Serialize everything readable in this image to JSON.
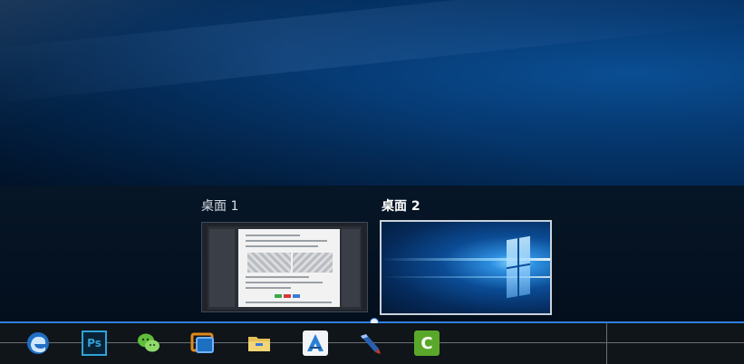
{
  "task_view": {
    "desktops": [
      {
        "label": "桌面 1",
        "active": false
      },
      {
        "label": "桌面 2",
        "active": true
      }
    ]
  },
  "taskbar": {
    "icons": [
      {
        "name": "edge-icon",
        "glyph": "e",
        "color": "#3a8de0"
      },
      {
        "name": "photoshop-icon",
        "glyph": "Ps",
        "color": "#2fa3d8"
      },
      {
        "name": "wechat-icon",
        "glyph": "",
        "color": "#5fbf3a"
      },
      {
        "name": "screen-capture-icon",
        "glyph": "",
        "color": "#e08a1a"
      },
      {
        "name": "file-explorer-icon",
        "glyph": "",
        "color": "#e3c15a"
      },
      {
        "name": "app-a-icon",
        "glyph": "A",
        "color": "#2a7fd4"
      },
      {
        "name": "pen-tool-icon",
        "glyph": "",
        "color": "#c23a2a"
      },
      {
        "name": "camtasia-icon",
        "glyph": "C",
        "color": "#5aa82a"
      }
    ]
  }
}
